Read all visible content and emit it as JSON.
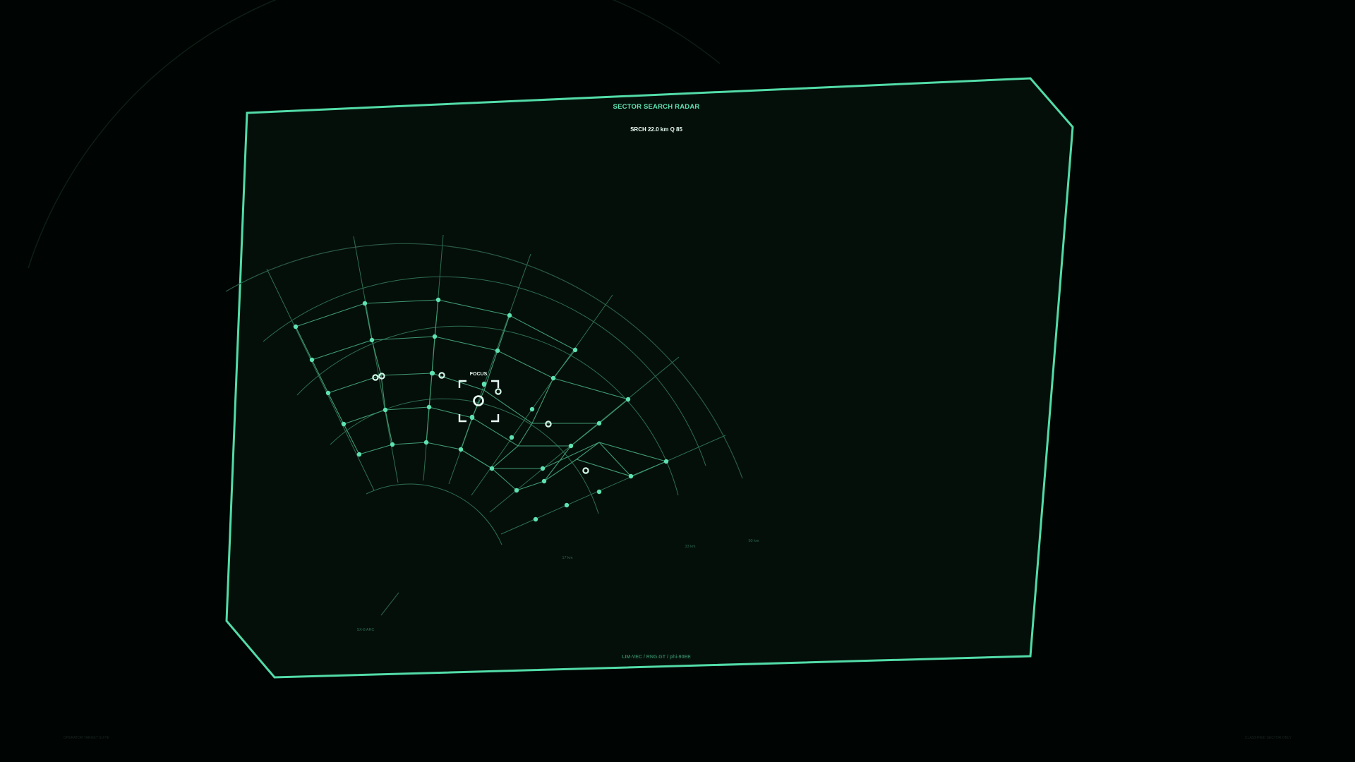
{
  "radar": {
    "title": "SECTOR SEARCH RADAR",
    "readout": "SRCH 22.0 km  Q 85",
    "focus_label": "FOCUS",
    "ranges": {
      "r1": "17 km",
      "r2": "33 km",
      "r3": "50 km"
    },
    "bearing_label": "SX-8 ARC",
    "footer": "LIM-VEC  /  RNG.GT  /  phi-90EE"
  },
  "corners": {
    "left": "OPERATOR TARGET SUITE",
    "right": "CLASSIFIED SECTOR ONLY"
  },
  "colors": {
    "accent": "#52dca8",
    "node": "#5fe2b2",
    "contact": "#cff5e6",
    "panel": "#050f0a",
    "background": "#000403"
  }
}
